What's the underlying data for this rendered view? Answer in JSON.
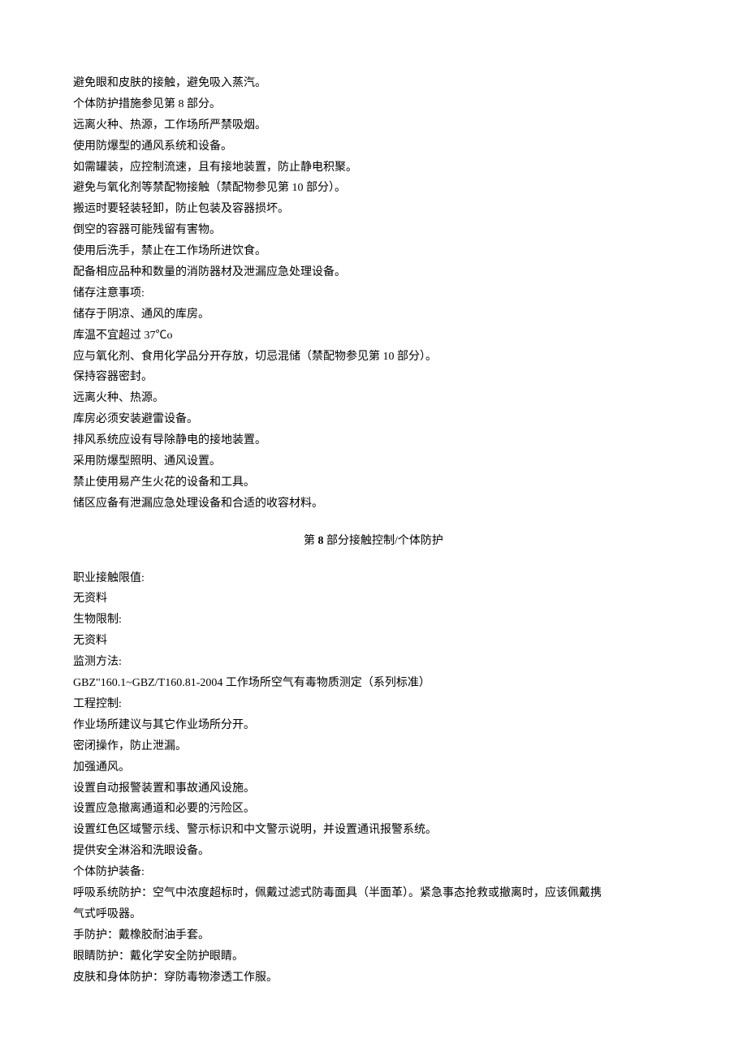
{
  "handling": [
    "避免眼和皮肤的接触，避免吸入蒸汽。",
    "个体防护措施参见第 8 部分。",
    "远离火种、热源，工作场所严禁吸烟。",
    "使用防爆型的通风系统和设备。",
    "如需罐装，应控制流速，且有接地装置，防止静电积聚。",
    "避免与氧化剂等禁配物接触（禁配物参见第 10 部分）。",
    "搬运时要轻装轻卸，防止包装及容器损坏。",
    "倒空的容器可能残留有害物。",
    "使用后洗手，禁止在工作场所进饮食。",
    "配备相应品种和数量的消防器材及泄漏应急处理设备。"
  ],
  "storage_label": "储存注意事项:",
  "storage": [
    "储存于阴凉、通风的库房。",
    "库温不宜超过 37℃o",
    "应与氧化剂、食用化学品分开存放，切忌混储（禁配物参见第 10 部分）。",
    "保持容器密封。",
    "远离火种、热源。",
    "库房必须安装避雷设备。",
    "排风系统应设有导除静电的接地装置。",
    "采用防爆型照明、通风设置。",
    "禁止使用易产生火花的设备和工具。",
    "储区应备有泄漏应急处理设备和合适的收容材料。"
  ],
  "section8_heading_prefix": "第",
  "section8_heading_num": " 8 ",
  "section8_heading_suffix": "部分接触控制/个体防护",
  "labels": {
    "occupational": "职业接触限值:",
    "occupational_val": "无资料",
    "biological": "生物限制:",
    "biological_val": "无资料",
    "monitoring": "监测方法:",
    "monitoring_val": "GBZ\"160.1~GBZ/T160.81-2004 工作场所空气有毒物质测定（系列标准）",
    "engineering": "工程控制:"
  },
  "engineering_controls": [
    "作业场所建议与其它作业场所分开。",
    "密闭操作，防止泄漏。",
    "加强通风。",
    "设置自动报警装置和事故通风设施。",
    "设置应急撤离通道和必要的污险区。",
    "设置红色区域警示线、警示标识和中文警示说明，并设置通讯报警系统。",
    "提供安全淋浴和洗眼设备。"
  ],
  "ppe_label": "个体防护装备:",
  "ppe": {
    "respiratory_1": "呼吸系统防护：空气中浓度超标时，佩戴过滤式防毒面具（半面革）。紧急事态抢救或撤离时，应该佩戴携",
    "respiratory_2": "气式呼吸器。",
    "hand": "手防护：戴橡胶耐油手套。",
    "eye": "眼睛防护：戴化学安全防护眼睛。",
    "skin": "皮肤和身体防护：穿防毒物渗透工作服。"
  }
}
